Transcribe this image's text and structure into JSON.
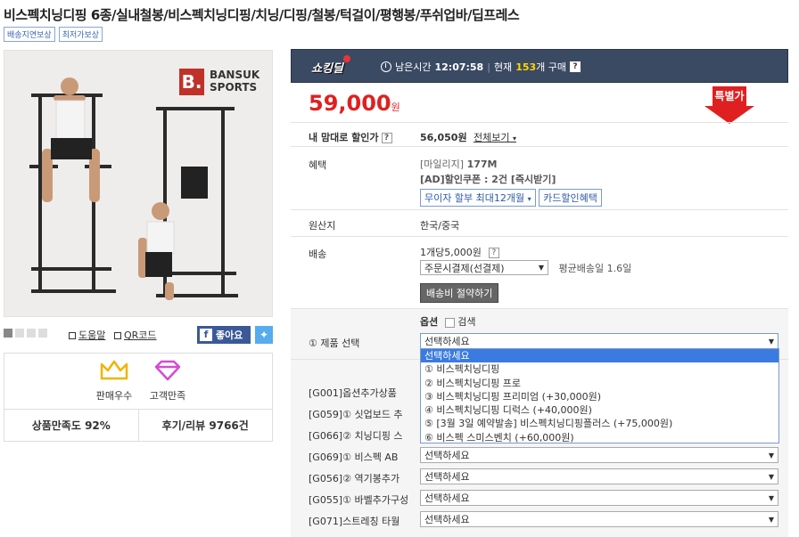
{
  "product": {
    "title": "비스펙치닝디핑 6종/실내철봉/비스펙치닝디핑/치닝/디핑/철봉/턱걸이/평행봉/푸쉬업바/딥프레스",
    "tags": [
      "배송지연보상",
      "최저가보상"
    ],
    "brand_mark": "B.",
    "brand_name_line1": "BANSUK",
    "brand_name_line2": "SPORTS"
  },
  "image_tools": {
    "help": "도움말",
    "qr": "QR코드",
    "facebook": "좋아요"
  },
  "badges": {
    "seller": "판매우수",
    "satisfaction": "고객만족",
    "rating_stat": "상품만족도 92%",
    "review_stat": "후기/리뷰 9766건"
  },
  "deal": {
    "logo": "쇼킹딜",
    "remain_label": "남은시간",
    "remain_time": "12:07:58",
    "divider": "|",
    "now_label": "현재",
    "count": "153",
    "count_suffix": "개 구매",
    "help": "?"
  },
  "price": {
    "amount": "59,000",
    "unit": "원",
    "special": "특별가"
  },
  "discount": {
    "label": "내 맘대로 할인가",
    "help": "?",
    "value": "56,050원",
    "view_all": "전체보기"
  },
  "benefit": {
    "label": "혜택",
    "mileage_prefix": "[마일리지]",
    "mileage_value": "177M",
    "coupon": "[AD]할인쿠폰 : 2건 [즉시받기]",
    "installment": "무이자 할부 최대12개월",
    "card": "카드할인혜택"
  },
  "origin": {
    "label": "원산지",
    "value": "한국/중국"
  },
  "shipping": {
    "label": "배송",
    "fee": "1개당5,000원",
    "help": "?",
    "method": "주문시결제(선결제)",
    "avg": "평균배송일 1.6일",
    "save_button": "배송비 절약하기"
  },
  "options": {
    "header_option": "옵션",
    "header_search": "검색",
    "product_select_label": "① 제품 선택",
    "placeholder": "선택하세요",
    "dropdown": [
      "선택하세요",
      "① 비스펙치닝디핑",
      "② 비스펙치닝디핑 프로",
      "③ 비스펙치닝디핑 프리미엄 (+30,000원)",
      "④ 비스펙치닝디핑 디럭스 (+40,000원)",
      "⑤ [3월 3일 예약발송] 비스펙치닝디핑플러스 (+75,000원)",
      "⑥ 비스펙 스미스벤치 (+60,000원)"
    ],
    "extra": [
      {
        "label": "[G001]옵션추가상품",
        "value": ""
      },
      {
        "label": "[G059]① 싯업보드 추",
        "value": ""
      },
      {
        "label": "[G066]② 치닝디핑 스",
        "value": ""
      },
      {
        "label": "[G069]① 비스펙 AB",
        "value": "선택하세요"
      },
      {
        "label": "[G056]② 역기봉추가",
        "value": "선택하세요"
      },
      {
        "label": "[G055]① 바벨추가구성",
        "value": "선택하세요"
      },
      {
        "label": "[G071]스트레칭 타월",
        "value": "선택하세요"
      }
    ]
  }
}
